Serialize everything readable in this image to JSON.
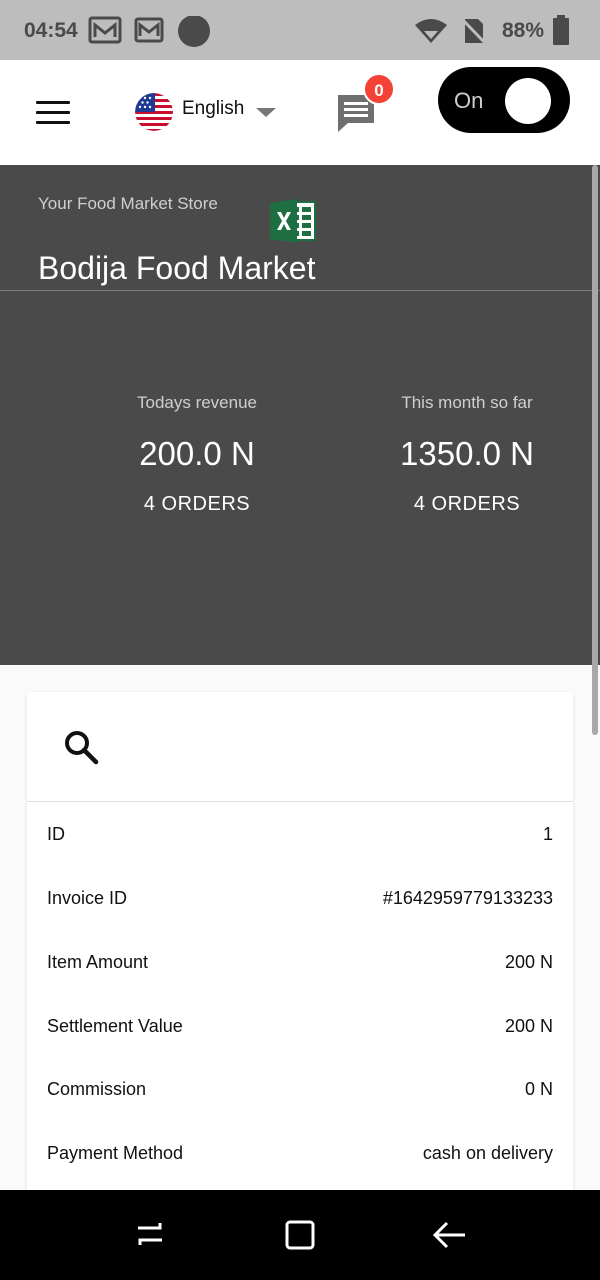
{
  "status_bar": {
    "time": "04:54",
    "battery": "88%",
    "icons": [
      "gmail-icon",
      "gmail-icon",
      "dot-icon",
      "wifi-icon",
      "no-sim-icon",
      "battery-icon"
    ]
  },
  "app_bar": {
    "language": "English",
    "chat_badge": "0",
    "toggle_label": "On"
  },
  "hero": {
    "subtitle": "Your Food Market Store",
    "store_name": "Bodija Food Market",
    "today": {
      "label": "Todays revenue",
      "value": "200.0 N",
      "orders": "4 ORDERS"
    },
    "month": {
      "label": "This month so far",
      "value": "1350.0 N",
      "orders": "4 ORDERS"
    }
  },
  "order": {
    "rows": [
      {
        "label": "ID",
        "value": "1"
      },
      {
        "label": "Invoice ID",
        "value": "#1642959779133233"
      },
      {
        "label": "Item Amount",
        "value": "200 N"
      },
      {
        "label": "Settlement Value",
        "value": "200 N"
      },
      {
        "label": "Commission",
        "value": "0 N"
      },
      {
        "label": "Payment Method",
        "value": "cash on delivery"
      }
    ]
  },
  "colors": {
    "hero_bg": "#4a4a4a",
    "badge": "#f44336",
    "excel_green": "#1d6f42"
  }
}
